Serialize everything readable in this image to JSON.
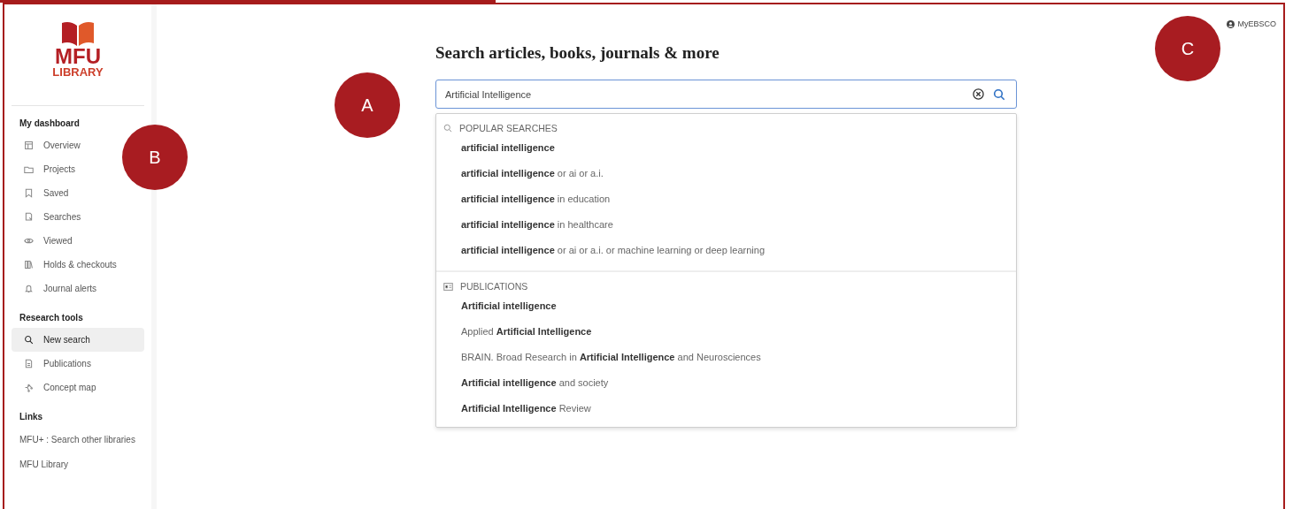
{
  "logo": {
    "title": "MFU",
    "subtitle": "LIBRARY"
  },
  "sidebar": {
    "sections": [
      {
        "title": "My dashboard",
        "items": [
          {
            "label": "Overview",
            "selected": false
          },
          {
            "label": "Projects",
            "selected": false
          },
          {
            "label": "Saved",
            "selected": false
          },
          {
            "label": "Searches",
            "selected": false
          },
          {
            "label": "Viewed",
            "selected": false
          },
          {
            "label": "Holds & checkouts",
            "selected": false
          },
          {
            "label": "Journal alerts",
            "selected": false
          }
        ]
      },
      {
        "title": "Research tools",
        "items": [
          {
            "label": "New search",
            "selected": true
          },
          {
            "label": "Publications",
            "selected": false
          },
          {
            "label": "Concept map",
            "selected": false
          }
        ]
      },
      {
        "title": "Links",
        "items": [
          {
            "label": "MFU+ : Search other libraries",
            "selected": false
          },
          {
            "label": "MFU Library",
            "selected": false
          }
        ]
      }
    ]
  },
  "account": {
    "label": "MyEBSCO"
  },
  "heading": "Search articles, books, journals & more",
  "search": {
    "value": "Artificial Intelligence"
  },
  "suggestions": [
    {
      "title": "POPULAR SEARCHES",
      "items": [
        "**artificial intelligence**",
        "**artificial intelligence** or ai or a.i.",
        "**artificial intelligence** in education",
        "**artificial intelligence** in healthcare",
        "**artificial intelligence** or ai or a.i. or machine learning or deep learning"
      ]
    },
    {
      "title": "PUBLICATIONS",
      "items": [
        "**Artificial intelligence**",
        "Applied **Artificial Intelligence**",
        "BRAIN. Broad Research in **Artificial Intelligence** and Neurosciences",
        "**Artificial intelligence** and society",
        "**Artificial Intelligence** Review"
      ]
    }
  ],
  "annotations": [
    {
      "label": "A"
    },
    {
      "label": "B"
    },
    {
      "label": "C"
    }
  ]
}
